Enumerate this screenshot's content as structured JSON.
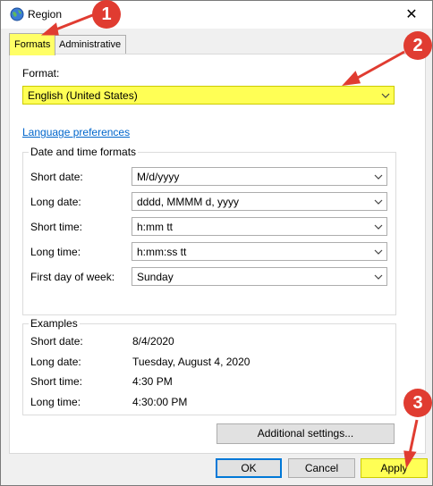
{
  "window": {
    "title": "Region"
  },
  "tabs": [
    {
      "label": "Formats"
    },
    {
      "label": "Administrative"
    }
  ],
  "format": {
    "label": "Format:",
    "value": "English (United States)"
  },
  "language_link": "Language preferences",
  "date_time": {
    "title": "Date and time formats",
    "rows": [
      {
        "label": "Short date:",
        "value": "M/d/yyyy"
      },
      {
        "label": "Long date:",
        "value": "dddd, MMMM d, yyyy"
      },
      {
        "label": "Short time:",
        "value": "h:mm tt"
      },
      {
        "label": "Long time:",
        "value": "h:mm:ss tt"
      },
      {
        "label": "First day of week:",
        "value": "Sunday"
      }
    ]
  },
  "examples": {
    "title": "Examples",
    "rows": [
      {
        "label": "Short date:",
        "value": "8/4/2020"
      },
      {
        "label": "Long date:",
        "value": "Tuesday, August 4, 2020"
      },
      {
        "label": "Short time:",
        "value": "4:30 PM"
      },
      {
        "label": "Long time:",
        "value": "4:30:00 PM"
      }
    ]
  },
  "additional_settings": "Additional settings...",
  "buttons": {
    "ok": "OK",
    "cancel": "Cancel",
    "apply": "Apply"
  },
  "markers": [
    "1",
    "2",
    "3"
  ],
  "colors": {
    "highlight": "#ffff55",
    "marker": "#e03c31",
    "link": "#0066cc"
  },
  "icons": {
    "window": "globe-icon",
    "close": "close-icon",
    "dropdown": "chevron-down-icon"
  }
}
